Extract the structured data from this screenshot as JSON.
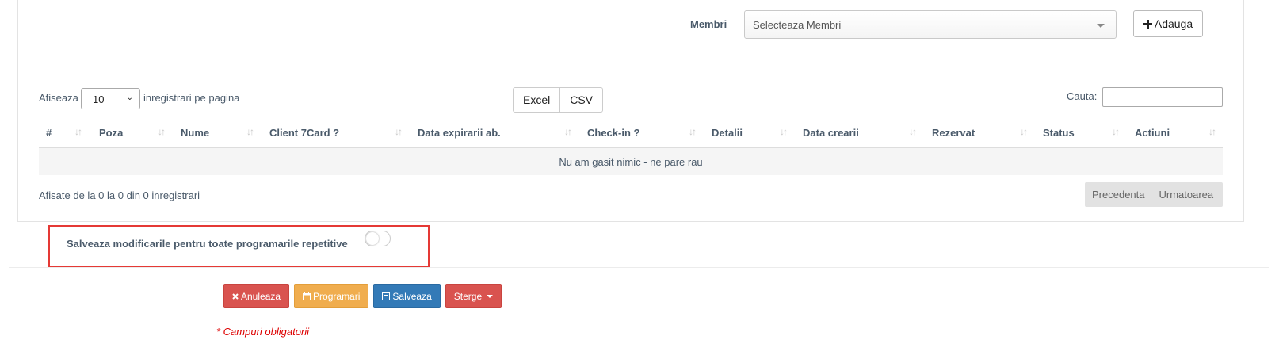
{
  "members": {
    "label": "Membri",
    "select_placeholder": "Selecteaza Membri",
    "add_button": "Adauga"
  },
  "table_controls": {
    "show_label": "Afiseaza",
    "page_length": "10",
    "per_page_label": "inregistrari pe pagina",
    "export_buttons": [
      "Excel",
      "CSV"
    ],
    "search_label": "Cauta:",
    "search_value": ""
  },
  "table": {
    "columns": [
      "#",
      "Poza",
      "Nume",
      "Client 7Card ?",
      "Data expirarii ab.",
      "Check-in ?",
      "Detalii",
      "Data crearii",
      "Rezervat",
      "Status",
      "Actiuni"
    ],
    "empty_message": "Nu am gasit nimic - ne pare rau",
    "info": "Afisate de la 0 la 0 din 0 inregistrari",
    "pager": {
      "prev": "Precedenta",
      "next": "Urmatoarea"
    }
  },
  "repeat_toggle": {
    "label": "Salveaza modificarile pentru toate programarile repetitive",
    "checked": false
  },
  "actions": {
    "cancel": "Anuleaza",
    "appointments": "Programari",
    "save": "Salveaza",
    "delete": "Sterge"
  },
  "required_note": "* Campuri obligatorii",
  "colors": {
    "danger": "#d9534f",
    "warning": "#f0ad4e",
    "primary": "#337ab7",
    "highlight": "#e53935"
  }
}
